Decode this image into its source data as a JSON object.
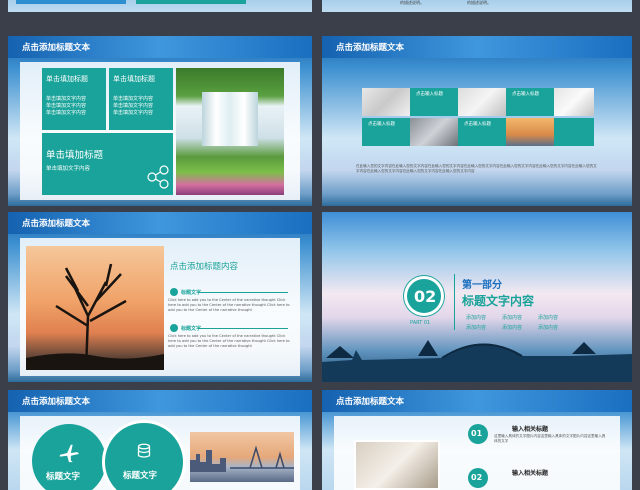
{
  "slides": {
    "top_left": {
      "text_a": "的描述说明。",
      "text_b": "的描述说明。"
    },
    "top_right": {
      "text_a": "的描述说明。",
      "text_b": "的描述说明。"
    },
    "s1": {
      "header": "点击添加标题文本",
      "box1_title": "单击填加标题",
      "box1_lines": [
        "单击填加文字内容",
        "单击填加文字内容",
        "单击填加文字内容"
      ],
      "box2_title": "单击填加标题",
      "box2_lines": [
        "单击填加文字内容",
        "单击填加文字内容",
        "单击填加文字内容"
      ],
      "big_title": "单击填加标题",
      "big_sub": "单击填加文字内容"
    },
    "s2": {
      "header": "点击添加标题文本",
      "labels": [
        "点击输入标题",
        "点击输入标题",
        "点击输入标题",
        "点击输入标题"
      ],
      "body": "在此输入您的文字内容在此输入您的文字内容在此输入您的文字内容在此输入您的文字内容在此输入您的文字内容在此输入您的文字内容在此输入您的文字内容在此输入您的文字内容在此输入您的文字内容在此输入您的文字内容"
    },
    "s3": {
      "header": "点击添加标题文本",
      "title": "点击添加标题内容",
      "item1_title": "标题文字",
      "item1_body": "Click here to add you to the Center of the narrative thought Click here to add you to the Center of the narrative thought Click here to add you to the Center of the narrative thought",
      "item2_title": "标题文字",
      "item2_body": "Click here to add you to the Center of the narrative thought Click here to add you to the Center of the narrative thought Click here to add you to the Center of the narrative thought"
    },
    "s4": {
      "number": "02",
      "part_label": "PART 01",
      "heading1": "第一部分",
      "heading2": "标题文字内容",
      "items": [
        "添加内容",
        "添加内容",
        "添加内容",
        "添加内容",
        "添加内容",
        "添加内容"
      ]
    },
    "s5": {
      "header": "点击添加标题文本",
      "circle1": "标题文字",
      "circle2": "标题文字"
    },
    "s6": {
      "header": "点击添加标题文本",
      "n1": "01",
      "t1": "输入相关标题",
      "d1": "这里输入具体的文字图片内容这里输入具体的文字图片内容这里输入具体的文字",
      "n2": "02",
      "t2": "输入相关标题"
    }
  },
  "colors": {
    "teal": "#1aa39a",
    "blue": "#1a6fc0",
    "frame": "#3a3f4a"
  }
}
